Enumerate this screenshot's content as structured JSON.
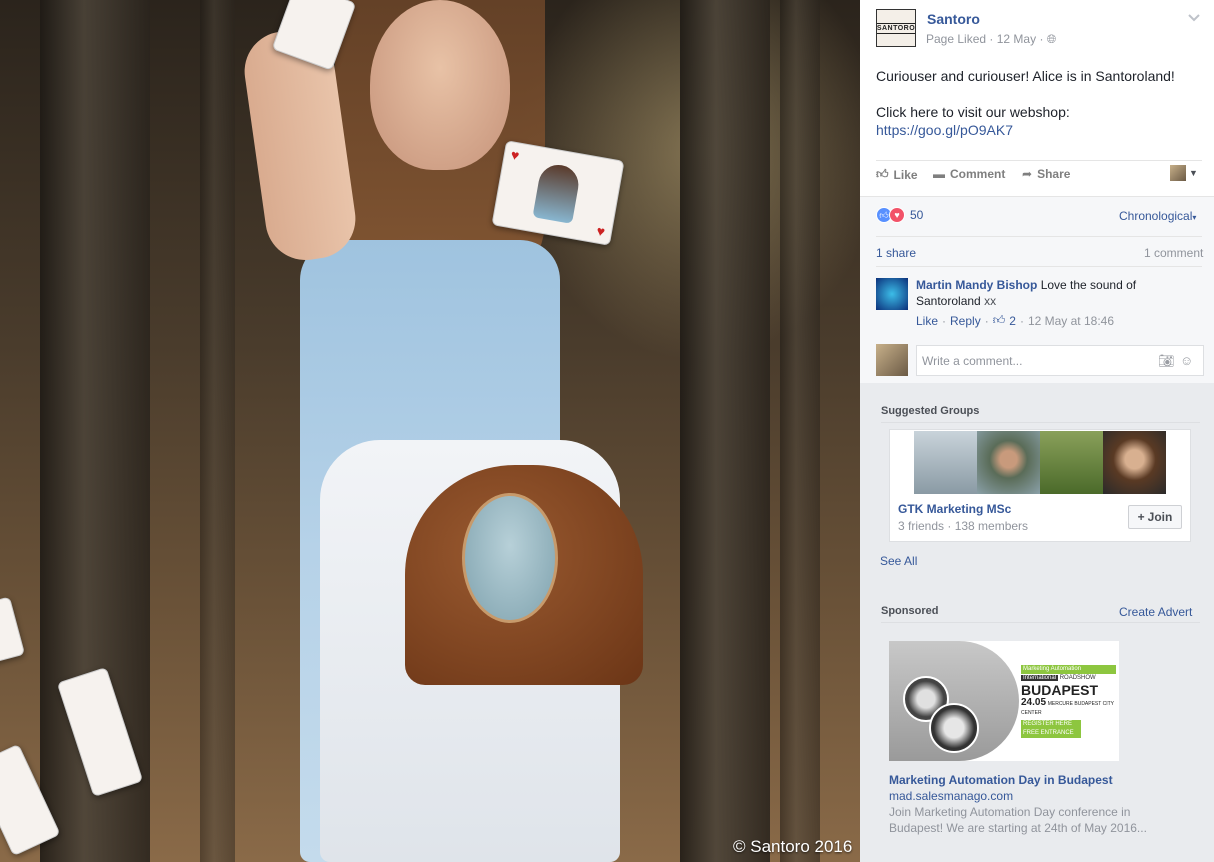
{
  "photo": {
    "watermark": "© Santoro 2016"
  },
  "post": {
    "page_name": "Santoro",
    "logo_text": "SANTORO",
    "status": "Page Liked",
    "date": "12 May",
    "text_line1": "Curiouser and curiouser! Alice is in Santoroland!",
    "text_line2": "Click here to visit our webshop:",
    "link": "https://goo.gl/pO9AK7",
    "actions": {
      "like": "Like",
      "comment": "Comment",
      "share": "Share"
    },
    "reaction_count": "50",
    "sort": "Chronological",
    "shares": "1 share",
    "comments_count": "1 comment",
    "comment": {
      "author": "Martin Mandy Bishop",
      "text": "Love the sound of Santoroland",
      "suffix": "xx",
      "like": "Like",
      "reply": "Reply",
      "likes": "2",
      "time": "12 May at 18:46"
    },
    "write_placeholder": "Write a comment..."
  },
  "suggested": {
    "title": "Suggested Groups",
    "group_name": "GTK Marketing MSc",
    "group_meta": "3 friends · 138 members",
    "join": "Join",
    "see_all": "See All"
  },
  "sponsored": {
    "title": "Sponsored",
    "create": "Create Advert",
    "ad_title": "Marketing Automation Day in Budapest",
    "ad_domain": "mad.salesmanago.com",
    "ad_desc": "Join Marketing Automation Day conference in Budapest! We are starting at 24th of May 2016...",
    "ad_banner": {
      "line1": "Marketing Automation",
      "line2": "International",
      "line3": "ROADSHOW",
      "city": "BUDAPEST",
      "date": "24.05",
      "venue": "MERCURE BUDAPEST CITY CENTER",
      "register": "REGISTER HERE",
      "free": "FREE ENTRANCE"
    }
  },
  "colors": {
    "link": "#365899",
    "like_blue": "#5890ff",
    "love_red": "#f25268"
  }
}
